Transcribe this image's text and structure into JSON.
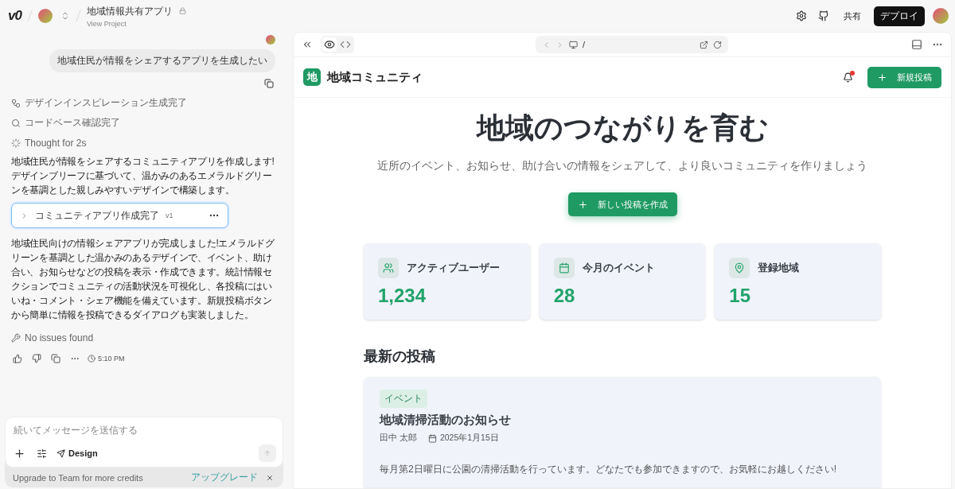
{
  "header": {
    "logo": "v0",
    "project": {
      "title": "地域情報共有アプリ",
      "subtitle": "View Project",
      "locked": true
    },
    "share": "共有",
    "deploy": "デプロイ"
  },
  "chat": {
    "user_message": "地域住民が情報をシェアするアプリを生成したい",
    "steps": [
      {
        "kind": "design",
        "text": "デザインインスピレーション生成完了"
      },
      {
        "kind": "search",
        "text": "コードベース確認完了"
      },
      {
        "kind": "thought",
        "text": "Thought for 2s"
      }
    ],
    "intro": "地域住民が情報をシェアするコミュニティアプリを作成します!デザインブリーフに基づいて、温かみのあるエメラルドグリーンを基調とした親しみやすいデザインで構築します。",
    "version_card": {
      "title": "コミュニティアプリ作成完了",
      "version": "v1",
      "expanded": false
    },
    "summary": "地域住民向けの情報シェアアプリが完成しました!エメラルドグリーンを基調とした温かみのあるデザインで、イベント、助け合い、お知らせなどの投稿を表示・作成できます。統計情報セクションでコミュニティの活動状況を可視化し、各投稿にはいいね・コメント・シェア機能を備えています。新規投稿ボタンから簡単に情報を投稿できるダイアログも実装しました。",
    "check": "No issues found",
    "time": "5:10 PM"
  },
  "composer": {
    "placeholder": "続いてメッセージを送信する",
    "mode": "Design"
  },
  "upgrade": {
    "text": "Upgrade to Team for more credits",
    "link": "アップグレード"
  },
  "preview": {
    "url": "/",
    "views": [
      {
        "kind": "preview",
        "selected": true
      },
      {
        "kind": "code",
        "selected": false
      }
    ]
  },
  "app": {
    "logo": "地",
    "name": "地域コミュニティ",
    "notification": true,
    "new_post": "新規投稿",
    "hero": {
      "title": "地域のつながりを育む",
      "subtitle": "近所のイベント、お知らせ、助け合いの情報をシェアして、より良いコミュニティを作りましょう",
      "button": "新しい投稿を作成"
    },
    "stats": [
      {
        "kind": "users",
        "label": "アクティブユーザー",
        "value": "1,234"
      },
      {
        "kind": "calendar",
        "label": "今月のイベント",
        "value": "28"
      },
      {
        "kind": "location",
        "label": "登録地域",
        "value": "15"
      }
    ],
    "section_title": "最新の投稿",
    "posts": [
      {
        "tag": "イベント",
        "title": "地域清掃活動のお知らせ",
        "author": "田中 太郎",
        "date": "2025年1月15日",
        "body": "毎月第2日曜日に公園の清掃活動を行っています。どなたでも参加できますので、お気軽にお越しください!"
      }
    ]
  }
}
